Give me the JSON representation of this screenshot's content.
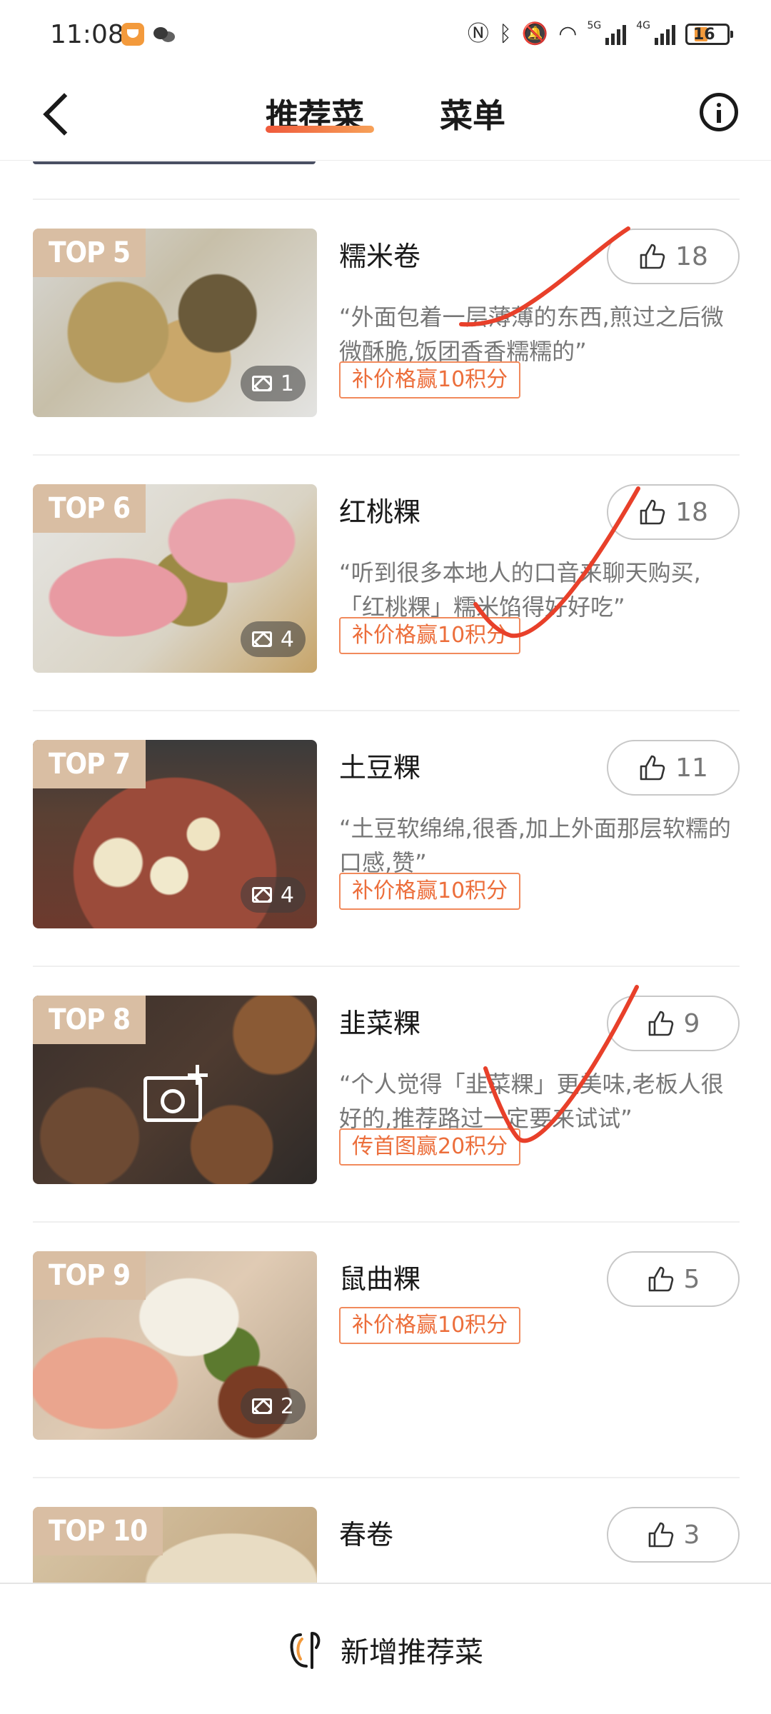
{
  "status_bar": {
    "time": "11:08",
    "net_label_1": "5G",
    "net_label_2": "4G",
    "battery": "16"
  },
  "header": {
    "tabs": [
      {
        "label": "推荐菜",
        "active": true
      },
      {
        "label": "菜单",
        "active": false
      }
    ]
  },
  "dishes": [
    {
      "rank": "TOP 5",
      "name": "糯米卷",
      "likes": "18",
      "quote": "“外面包着一层薄薄的东西,煎过之后微微酥脆,饭团香香糯糯的”",
      "photos": "1",
      "tag": "补价格赢10积分",
      "has_photo": true
    },
    {
      "rank": "TOP 6",
      "name": "红桃粿",
      "likes": "18",
      "quote": "“听到很多本地人的口音来聊天购买,「红桃粿」糯米馅得好好吃”",
      "photos": "4",
      "tag": "补价格赢10积分",
      "has_photo": true
    },
    {
      "rank": "TOP 7",
      "name": "土豆粿",
      "likes": "11",
      "quote": "“土豆软绵绵,很香,加上外面那层软糯的口感,赞”",
      "photos": "4",
      "tag": "补价格赢10积分",
      "has_photo": true
    },
    {
      "rank": "TOP 8",
      "name": "韭菜粿",
      "likes": "9",
      "quote": "“个人觉得「韭菜粿」更美味,老板人很好的,推荐路过一定要来试试”",
      "photos": "",
      "tag": "传首图赢20积分",
      "has_photo": false
    },
    {
      "rank": "TOP 9",
      "name": "鼠曲粿",
      "likes": "5",
      "quote": "",
      "photos": "2",
      "tag": "补价格赢10积分",
      "has_photo": true
    },
    {
      "rank": "TOP 10",
      "name": "春卷",
      "likes": "3",
      "quote": "",
      "photos": "",
      "tag": "",
      "has_photo": true
    }
  ],
  "bottom": {
    "add_label": "新增推荐菜"
  },
  "colors": {
    "accent_orange": "#ec6e3b",
    "rank_badge": "#d9bea3",
    "annotation_red": "#e8402a"
  },
  "icons": [
    "back-arrow-icon",
    "info-icon",
    "thumbs-up-icon",
    "image-icon",
    "camera-add-icon",
    "chef-hat-icon"
  ]
}
